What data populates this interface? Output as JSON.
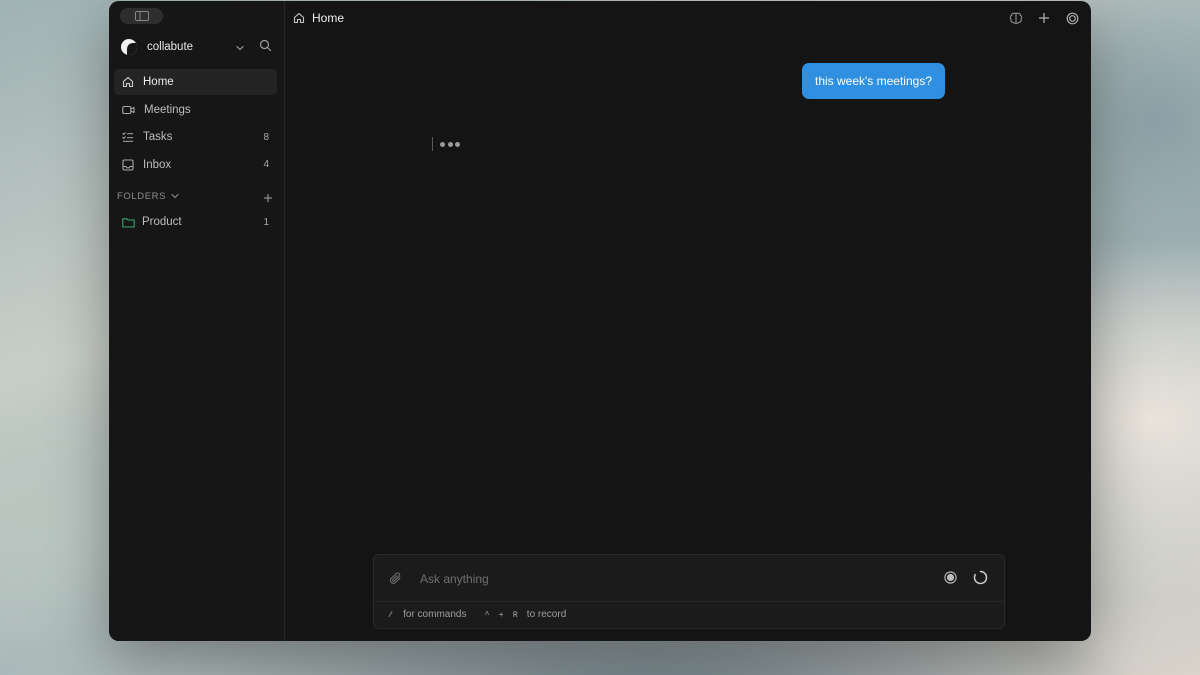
{
  "sidebar": {
    "workspace": {
      "name": "collabute"
    },
    "nav": [
      {
        "label": "Home",
        "icon": "home-icon",
        "count": ""
      },
      {
        "label": "Meetings",
        "icon": "video-icon",
        "count": ""
      },
      {
        "label": "Tasks",
        "icon": "checklist-icon",
        "count": "8"
      },
      {
        "label": "Inbox",
        "icon": "inbox-icon",
        "count": "4"
      }
    ],
    "folders_label": "FOLDERS",
    "folders": [
      {
        "label": "Product",
        "count": "1",
        "icon": "folder-icon",
        "color": "#3aa76d"
      }
    ]
  },
  "header": {
    "title": "Home"
  },
  "chat": {
    "user_message": "this week's meetings?",
    "status": "typing"
  },
  "composer": {
    "placeholder": "Ask anything",
    "value": "",
    "hints": {
      "slash_key": "/",
      "slash_text": "for commands",
      "ctrl_key": "^",
      "plus": "+",
      "r_key": "R",
      "record_text": "to record"
    }
  },
  "colors": {
    "accent": "#2f8fe0",
    "window_bg": "#141414",
    "sidebar_bg": "#161616"
  }
}
